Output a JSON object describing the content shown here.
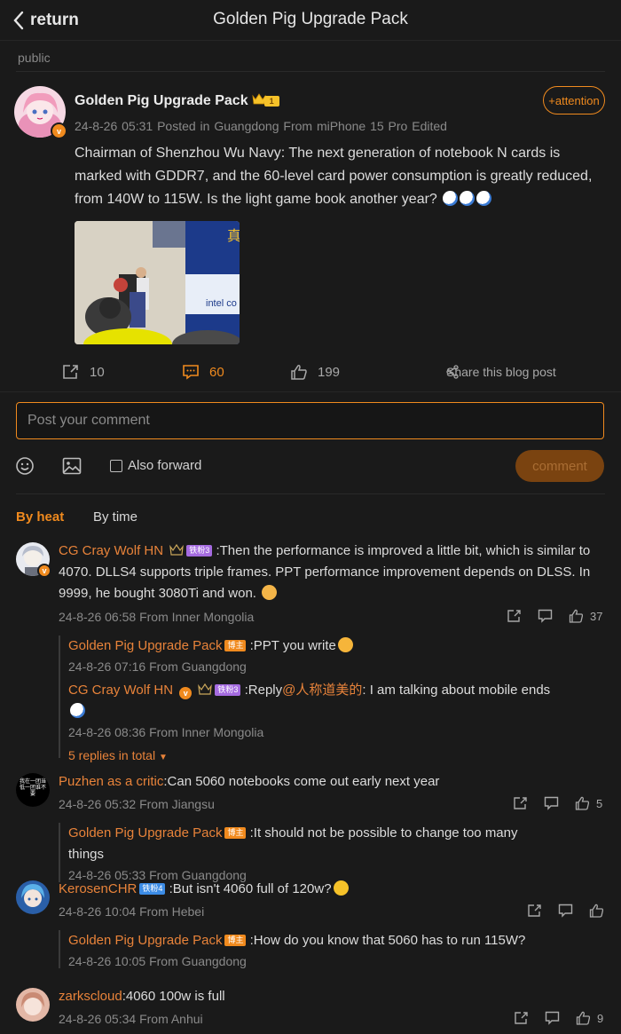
{
  "header": {
    "back_label": "return",
    "title": "Golden Pig Upgrade Pack"
  },
  "visibility": "public",
  "post": {
    "author": "Golden Pig Upgrade Pack",
    "level_badge": "1",
    "follow_label": "+attention",
    "meta": "24-8-26 05:31  Posted in Guangdong  From miPhone 15 Pro Edited",
    "text": "Chairman of Shenzhou Wu Navy: The next generation of notebook N cards is marked with GDDR7, and the 60-level card power consumption is greatly reduced, from 140W to 115W. Is the light game book another year?",
    "image_banner_text": "intel co",
    "image_banner_cjk": "真",
    "repost_count": "10",
    "comment_count": "60",
    "like_count": "199",
    "share_label": "Share this blog post"
  },
  "composer": {
    "placeholder": "Post your comment",
    "forward_label": "Also forward",
    "submit_label": "comment"
  },
  "tabs": {
    "heat": "By heat",
    "time": "By time"
  },
  "comments": [
    {
      "name": "CG Cray Wolf HN",
      "badge": "铁粉3",
      "text": ":Then the performance is improved a little bit, which is similar to 4070. DLLS4 supports triple frames. PPT performance improvement depends on DLSS. In 9999, he bought 3080Ti and won.",
      "meta": "24-8-26 06:58 From Inner Mongolia",
      "likes": "37",
      "replies": [
        {
          "name": "Golden Pig Upgrade Pack",
          "badge": "博主",
          "text": ":PPT you write",
          "meta": "24-8-26 07:16 From Guangdong"
        },
        {
          "name": "CG Cray Wolf HN",
          "badge": "铁粉3",
          "text_prefix": ":Reply",
          "mention": "@人称道美的",
          "text": ": I am talking about mobile ends",
          "meta": "24-8-26 08:36 From Inner Mongolia"
        }
      ],
      "more_replies": "5 replies in total"
    },
    {
      "name": "Puzhen as a critic",
      "avatar_text": "我在一团当低一团谁不要",
      "text": ":Can 5060 notebooks come out early next year",
      "meta": "24-8-26 05:32 From Jiangsu",
      "likes": "5",
      "replies": [
        {
          "name": "Golden Pig Upgrade Pack",
          "badge": "博主",
          "text": ":It should not be possible to change too many things",
          "meta": "24-8-26 05:33 From Guangdong"
        }
      ]
    },
    {
      "name": "KerosenCHR",
      "badge": "铁粉4",
      "text": ":But isn't 4060 full of 120w?",
      "meta": "24-8-26 10:04 From Hebei",
      "likes": "",
      "replies": [
        {
          "name": "Golden Pig Upgrade Pack",
          "badge": "博主",
          "text": ":How do you know that 5060 has to run 115W?",
          "meta": "24-8-26 10:05 From Guangdong"
        }
      ]
    },
    {
      "name": "zarkscloud",
      "text": ":4060 100w is full",
      "meta": "24-8-26 05:34 From Anhui",
      "likes": "9"
    }
  ],
  "colors": {
    "accent": "#f08a1e",
    "background": "#1a1a1a",
    "name_link": "#e8833a"
  }
}
